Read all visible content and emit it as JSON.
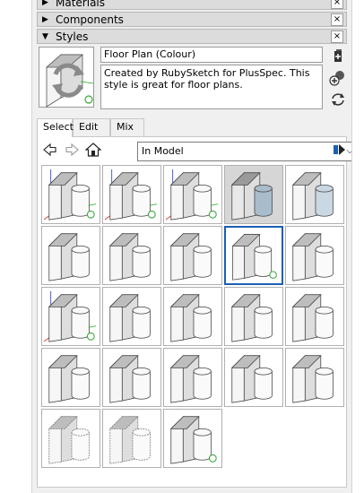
{
  "trays": {
    "materials": {
      "label": "Materials",
      "expanded": false
    },
    "components": {
      "label": "Components",
      "expanded": false
    },
    "styles": {
      "label": "Styles",
      "expanded": true
    }
  },
  "icons": {
    "collapsed": "▶",
    "expanded": "▼",
    "close": "×",
    "dropdown": "⌵"
  },
  "style_info": {
    "name": "Floor Plan (Colour)",
    "description": "Created by RubySketch for PlusSpec. This style is great for floor plans."
  },
  "side_buttons": [
    "create-style-icon",
    "update-style-icon",
    "refresh-icon"
  ],
  "tabs": [
    {
      "label": "Select",
      "active": true
    },
    {
      "label": "Edit",
      "active": false
    },
    {
      "label": "Mix",
      "active": false
    }
  ],
  "navigation": {
    "back_icon": "back-arrow-icon",
    "forward_icon": "forward-arrow-icon",
    "home_icon": "home-icon",
    "collection": "In Model",
    "details_icon": "details-arrow-icon"
  },
  "styles": [
    {
      "variant": "axes-in-model"
    },
    {
      "variant": "axes-in-model"
    },
    {
      "variant": "axes-in-model"
    },
    {
      "variant": "shaded-blue"
    },
    {
      "variant": "plain-blue"
    },
    {
      "variant": "plain"
    },
    {
      "variant": "plain"
    },
    {
      "variant": "plain"
    },
    {
      "variant": "in-model",
      "selected": true
    },
    {
      "variant": "plain"
    },
    {
      "variant": "axes-in-model"
    },
    {
      "variant": "plain"
    },
    {
      "variant": "plain"
    },
    {
      "variant": "plain"
    },
    {
      "variant": "plain"
    },
    {
      "variant": "plain"
    },
    {
      "variant": "plain"
    },
    {
      "variant": "plain"
    },
    {
      "variant": "plain"
    },
    {
      "variant": "plain"
    },
    {
      "variant": "sketchy"
    },
    {
      "variant": "sketchy"
    },
    {
      "variant": "in-model"
    }
  ],
  "colors": {
    "selection": "#1a5fb4",
    "in_model_marker": "#3aa63a",
    "axis_red": "#cc2020",
    "axis_green": "#22aa22",
    "axis_blue": "#2030cc"
  }
}
